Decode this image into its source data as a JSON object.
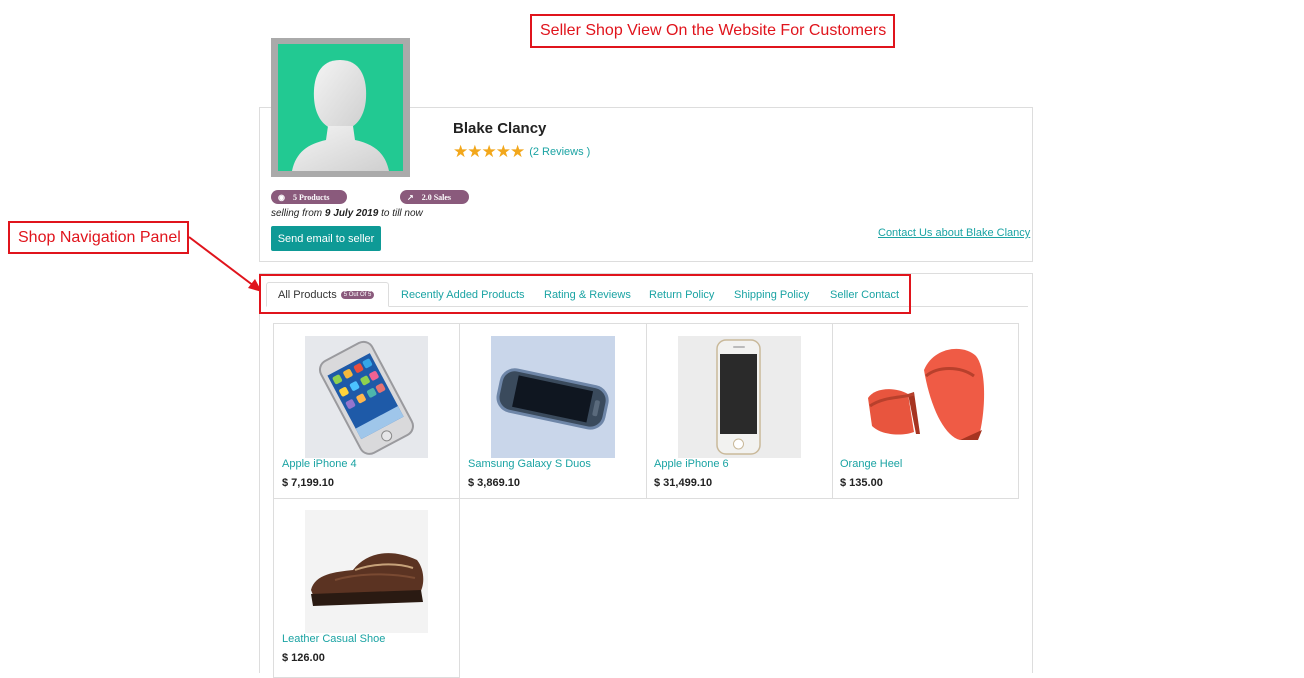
{
  "annotations": {
    "title": "Seller Shop View On the Website For Customers",
    "nav_panel": "Shop Navigation Panel"
  },
  "seller": {
    "name": "Blake Clancy",
    "stars": "★★★★★",
    "rating_value": 5,
    "reviews_text": "(2 Reviews )",
    "products_badge": "5 Products",
    "sales_badge": "2.0 Sales",
    "selling_prefix": "selling from",
    "selling_date": "9 July 2019",
    "selling_suffix": "to till now",
    "email_button": "Send email to seller",
    "contact_link": "Contact Us about Blake Clancy"
  },
  "tabs": [
    {
      "label": "All Products",
      "badge": "5 Out Of 5",
      "active": true
    },
    {
      "label": "Recently Added Products"
    },
    {
      "label": "Rating & Reviews"
    },
    {
      "label": "Return Policy"
    },
    {
      "label": "Shipping Policy"
    },
    {
      "label": "Seller Contact"
    }
  ],
  "products": [
    {
      "name": "Apple iPhone 4",
      "price": "$ 7,199.10"
    },
    {
      "name": "Samsung Galaxy S Duos",
      "price": "$ 3,869.10"
    },
    {
      "name": "Apple iPhone 6",
      "price": "$ 31,499.10"
    },
    {
      "name": "Orange Heel",
      "price": "$ 135.00"
    },
    {
      "name": "Leather Casual Shoe",
      "price": "$ 126.00"
    }
  ],
  "colors": {
    "accent": "#1aa3a3",
    "button": "#0e9a96",
    "badge": "#8a5a7c",
    "annotation": "#e0141c",
    "avatar_bg": "#22c992",
    "star": "#f2a71b"
  }
}
